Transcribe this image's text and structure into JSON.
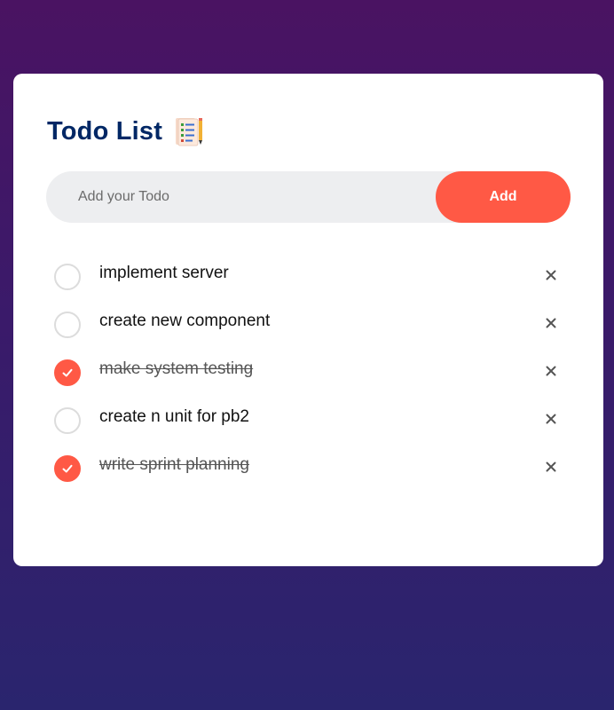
{
  "header": {
    "title": "Todo List"
  },
  "input": {
    "placeholder": "Add your Todo",
    "value": ""
  },
  "add_button": {
    "label": "Add"
  },
  "todos": [
    {
      "text": "implement server",
      "checked": false
    },
    {
      "text": "create new component",
      "checked": false
    },
    {
      "text": "make system testing",
      "checked": true
    },
    {
      "text": "create n unit for pb2",
      "checked": false
    },
    {
      "text": "write sprint planning",
      "checked": true
    }
  ],
  "icons": {
    "title_icon": "checklist-notepad-icon",
    "check_icon": "checkmark-icon",
    "delete_icon": "close-icon"
  },
  "colors": {
    "accent": "#ff5945",
    "title": "#002765",
    "input_bg": "#edeef0",
    "background_top": "#4a1362",
    "background_bottom": "#2a256e"
  }
}
